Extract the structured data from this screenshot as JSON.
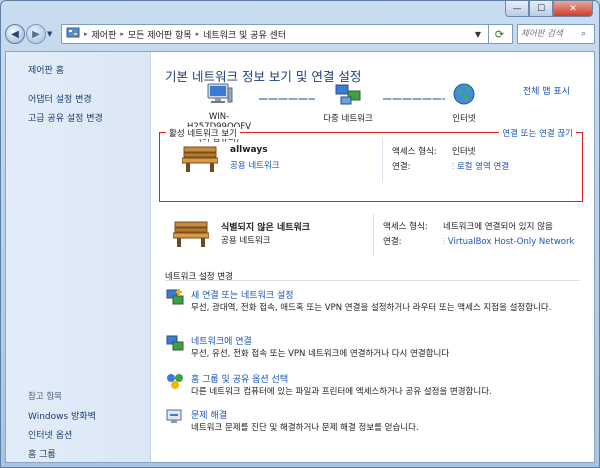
{
  "window": {
    "minimize": "—",
    "maximize": "☐",
    "close": "✕"
  },
  "nav": {
    "back_icon": "◀",
    "forward_icon": "▶",
    "history_icon": "▼"
  },
  "breadcrumb": {
    "sep": "▸",
    "items": [
      "제어판",
      "모든 제어판 항목",
      "네트워크 및 공유 센터"
    ]
  },
  "search": {
    "placeholder": "제어판 검색"
  },
  "sidebar": {
    "home": "제어판 홈",
    "items": [
      "어댑터 설정 변경",
      "고급 공유 설정 변경"
    ],
    "see_also_title": "참고 항목",
    "see_also": [
      "Windows 방화벽",
      "인터넷 옵션",
      "홈 그룹"
    ]
  },
  "main": {
    "title": "기본 네트워크 정보 보기 및 연결 설정",
    "full_map": "전체 맵 표시",
    "map": {
      "computer_name": "WIN-H257D99OOFV",
      "computer_sub": "(이 컴퓨터)",
      "multiple": "다중 네트워크",
      "internet": "인터넷"
    },
    "active_title": "활성 네트워크 보기",
    "connect_link": "연결 또는 연결 끊기",
    "networks": [
      {
        "name": "allways",
        "type": "공용 네트워크",
        "access_label": "액세스 형식:",
        "access_value": "인터넷",
        "conn_label": "연결:",
        "conn_value": "로컬 영역 연결"
      },
      {
        "name": "식별되지 않은 네트워크",
        "type": "공용 네트워크",
        "access_label": "액세스 형식:",
        "access_value": "네트워크에 연결되어 있지 않음",
        "conn_label": "연결:",
        "conn_value": "VirtualBox Host-Only Network"
      }
    ],
    "settings_title": "네트워크 설정 변경",
    "tasks": [
      {
        "link": "새 연결 또는 네트워크 설정",
        "desc": "무선, 광대역, 전화 접속, 애드혹 또는 VPN 연결을 설정하거나 라우터 또는 액세스 지점을 설정합니다."
      },
      {
        "link": "네트워크에 연결",
        "desc": "무선, 유선, 전화 접속 또는 VPN 네트워크에 연결하거나 다시 연결합니다"
      },
      {
        "link": "홈 그룹 및 공유 옵션 선택",
        "desc": "다른 네트워크 컴퓨터에 있는 파일과 프린터에 액세스하거나 공유 설정을 변경합니다."
      },
      {
        "link": "문제 해결",
        "desc": "네트워크 문제를 진단 및 해결하거나 문제 해결 정보를 얻습니다."
      }
    ]
  },
  "colors": {
    "link": "#1a56b4",
    "title": "#1a3e7a",
    "highlight_border": "#e02020"
  }
}
